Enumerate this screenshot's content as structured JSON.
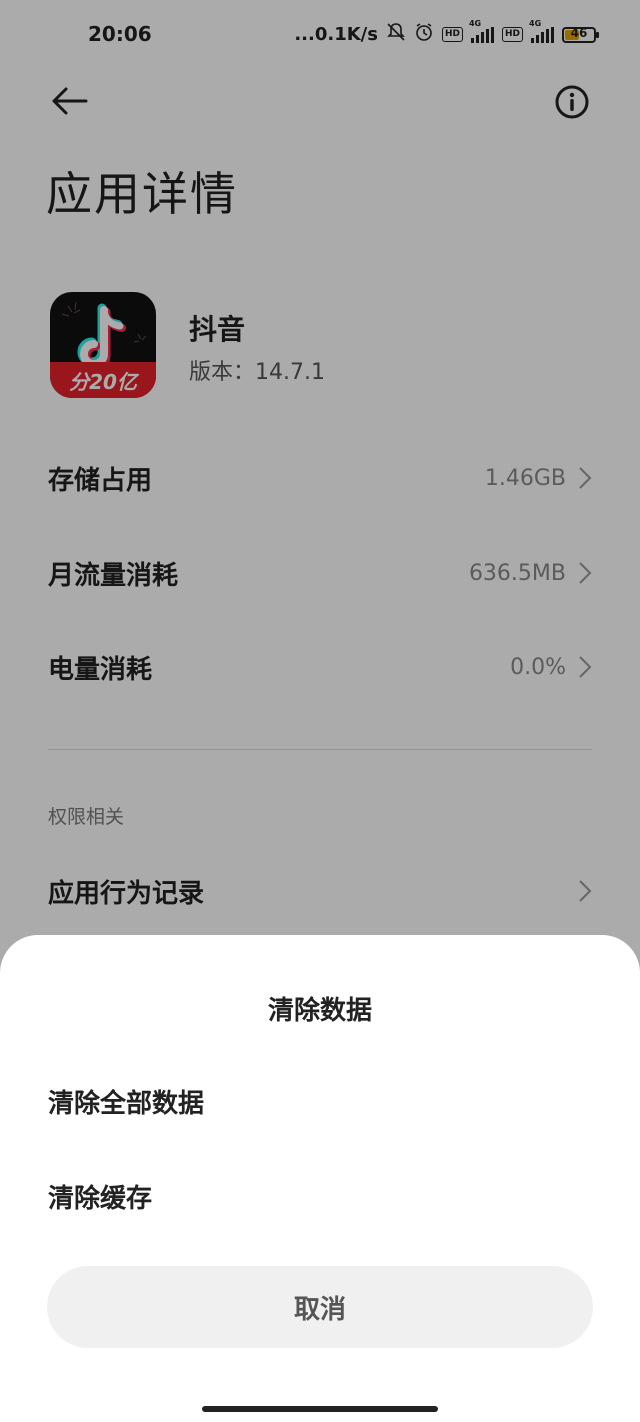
{
  "status_bar": {
    "time": "20:06",
    "network_speed": "...0.1K/s",
    "hd1": "HD",
    "network1": "4G",
    "hd2": "HD",
    "network2": "4G",
    "battery_level": "46",
    "icons": [
      "mute-bell-icon",
      "alarm-icon",
      "signal-icon",
      "battery-icon"
    ]
  },
  "header": {
    "title": "应用详情"
  },
  "app": {
    "name": "抖音",
    "version": "版本：14.7.1",
    "icon_banner": "分20亿",
    "icon_colors": {
      "bg": "#111111",
      "banner": "#e5222c",
      "cyan": "#25f4ee",
      "pink": "#fe2c55"
    }
  },
  "rows": [
    {
      "label": "存储占用",
      "value": "1.46GB"
    },
    {
      "label": "月流量消耗",
      "value": "636.5MB"
    },
    {
      "label": "电量消耗",
      "value": "0.0%"
    }
  ],
  "permissions": {
    "section_title": "权限相关",
    "behavior_record": "应用行为记录"
  },
  "sheet": {
    "title": "清除数据",
    "options": [
      "清除全部数据",
      "清除缓存"
    ],
    "cancel": "取消"
  }
}
